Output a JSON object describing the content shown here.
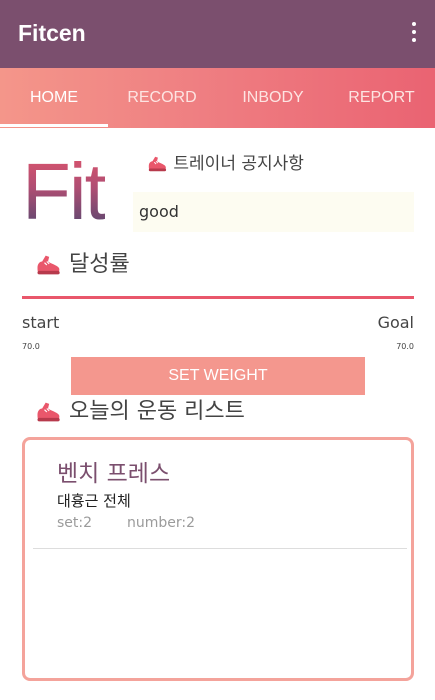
{
  "app": {
    "title": "Fitcen",
    "menu_icon": "more-vert-icon"
  },
  "tabs": [
    {
      "label": "HOME",
      "active": true
    },
    {
      "label": "RECORD",
      "active": false
    },
    {
      "label": "INBODY",
      "active": false
    },
    {
      "label": "REPORT",
      "active": false
    }
  ],
  "logo_text": "Fit",
  "notice": {
    "icon": "running-shoe-icon",
    "heading": "트레이너 공지사항",
    "text": "good"
  },
  "achievement": {
    "icon": "running-shoe-icon",
    "heading": "달성률",
    "progress": 1.0,
    "start_label": "start",
    "goal_label": "Goal",
    "start_value": "70.0",
    "goal_value": "70.0"
  },
  "set_weight_label": "SET WEIGHT",
  "workout_list": {
    "icon": "running-shoe-icon",
    "heading": "오늘의 운동 리스트",
    "items": [
      {
        "name": "벤치 프레스",
        "muscle": "대흉근 전체",
        "set": "set:2",
        "number": "number:2"
      }
    ]
  },
  "colors": {
    "appbar": "#7b4f6e",
    "tab_gradient_start": "#f4968a",
    "tab_gradient_end": "#ea6372",
    "accent": "#e9576b",
    "button": "#f4978e",
    "card_border": "#f4a39b"
  }
}
